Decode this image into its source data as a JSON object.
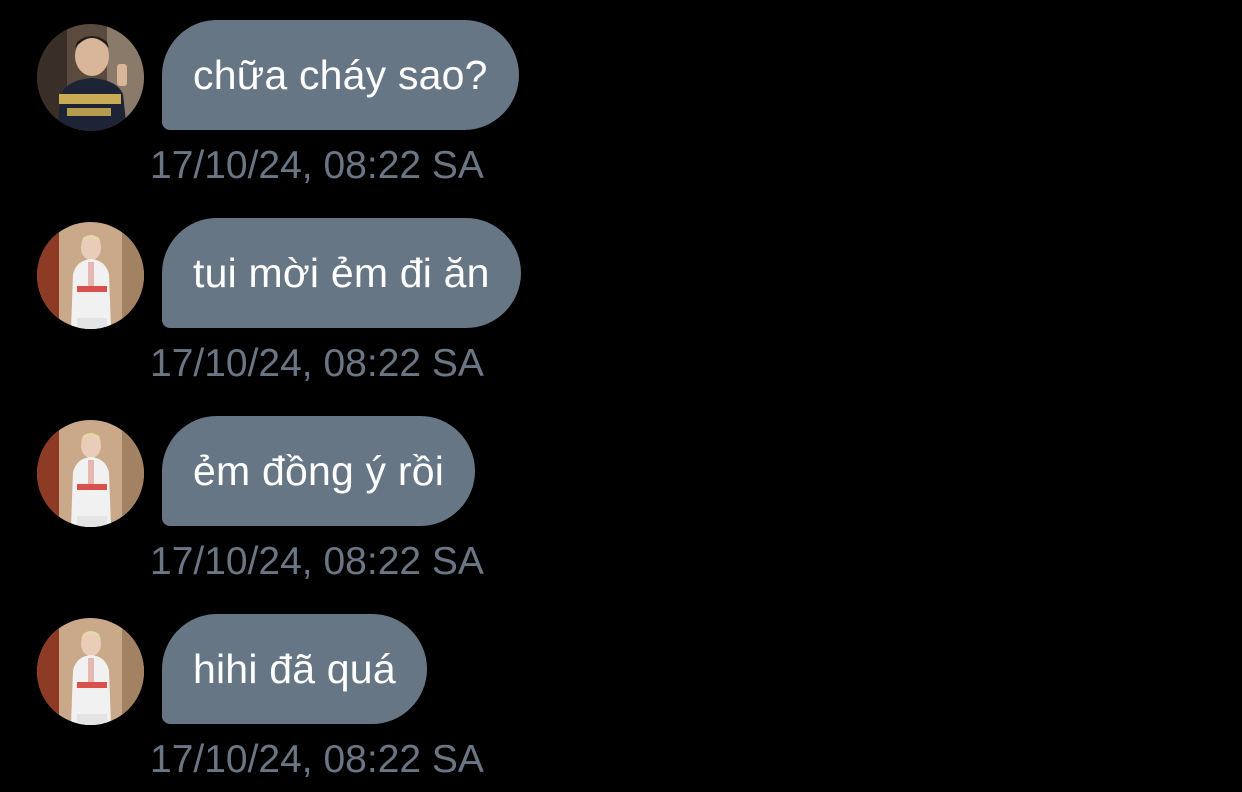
{
  "colors": {
    "background": "#000000",
    "bubble": "#677685",
    "bubble_text": "#ffffff",
    "timestamp": "#6b7684"
  },
  "messages": [
    {
      "avatar": "user-photo-black-tshirt",
      "text": "chữa cháy sao?",
      "timestamp": "17/10/24, 08:22 SA"
    },
    {
      "avatar": "user-photo-white-outfit",
      "text": "tui mời ẻm đi ăn",
      "timestamp": "17/10/24, 08:22 SA"
    },
    {
      "avatar": "user-photo-white-outfit",
      "text": "ẻm đồng ý rồi",
      "timestamp": "17/10/24, 08:22 SA"
    },
    {
      "avatar": "user-photo-white-outfit",
      "text": "hihi đã quá",
      "timestamp": "17/10/24, 08:22 SA"
    }
  ]
}
